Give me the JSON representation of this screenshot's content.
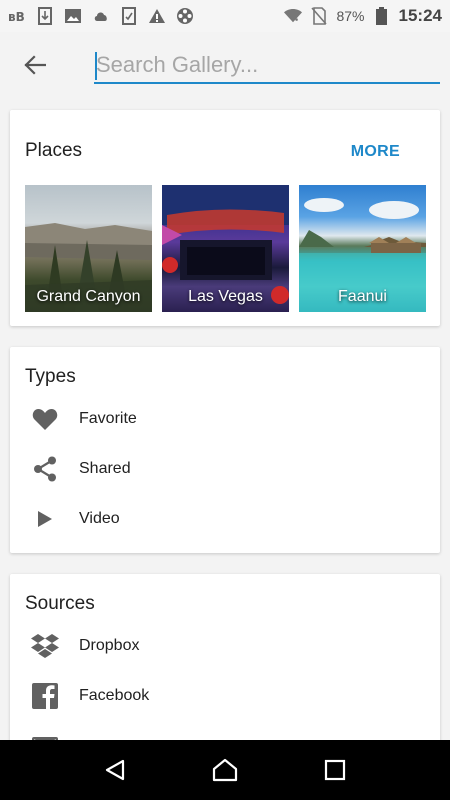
{
  "status_bar": {
    "battery_percent": "87%",
    "time": "15:24",
    "icons": [
      "bb-icon",
      "download-icon",
      "image-icon",
      "cloud-icon",
      "sim-icon",
      "warning-icon",
      "film-reel-icon",
      "wifi-icon",
      "no-sim-icon",
      "battery-icon"
    ]
  },
  "search": {
    "placeholder": "Search Gallery..."
  },
  "places": {
    "title": "Places",
    "more_label": "MORE",
    "items": [
      {
        "label": "Grand Canyon"
      },
      {
        "label": "Las Vegas"
      },
      {
        "label": "Faanui"
      }
    ]
  },
  "types": {
    "title": "Types",
    "items": [
      {
        "label": "Favorite",
        "icon": "heart-icon"
      },
      {
        "label": "Shared",
        "icon": "share-icon"
      },
      {
        "label": "Video",
        "icon": "play-icon"
      }
    ]
  },
  "sources": {
    "title": "Sources",
    "items": [
      {
        "label": "Dropbox",
        "icon": "dropbox-icon"
      },
      {
        "label": "Facebook",
        "icon": "facebook-icon"
      }
    ]
  },
  "colors": {
    "accent": "#1e88c9",
    "icon": "#616161"
  }
}
